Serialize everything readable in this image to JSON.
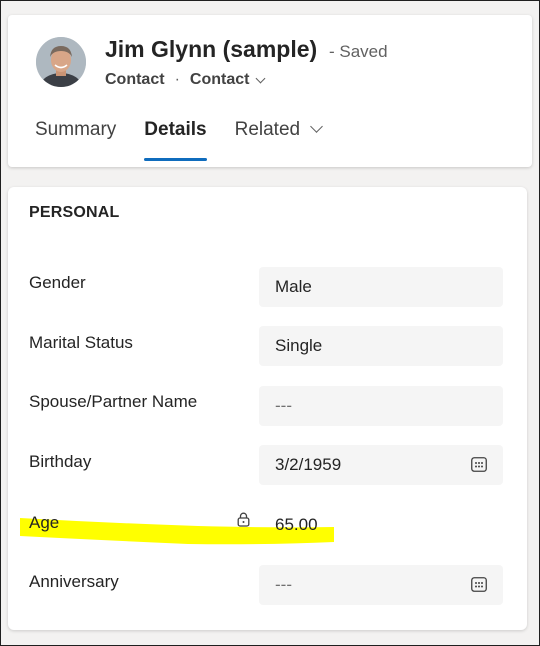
{
  "header": {
    "title": "Jim Glynn (sample)",
    "save_status": "- Saved",
    "entity": "Contact",
    "separator": "·",
    "form_selector": "Contact"
  },
  "tabs": [
    {
      "label": "Summary",
      "active": false
    },
    {
      "label": "Details",
      "active": true
    },
    {
      "label": "Related",
      "active": false
    }
  ],
  "section": {
    "title": "PERSONAL",
    "fields": [
      {
        "label": "Gender",
        "value": "Male"
      },
      {
        "label": "Marital Status",
        "value": "Single"
      },
      {
        "label": "Spouse/Partner Name",
        "value": "---"
      },
      {
        "label": "Birthday",
        "value": "3/2/1959",
        "icon": "calendar-icon"
      },
      {
        "label": "Age",
        "value": "65.00",
        "icon": "lock-icon",
        "highlighted": true
      },
      {
        "label": "Anniversary",
        "value": "---",
        "icon": "calendar-icon"
      }
    ]
  },
  "colors": {
    "accent": "#0f6cbd",
    "highlight": "#ffff00",
    "field_background": "#f5f5f5"
  }
}
